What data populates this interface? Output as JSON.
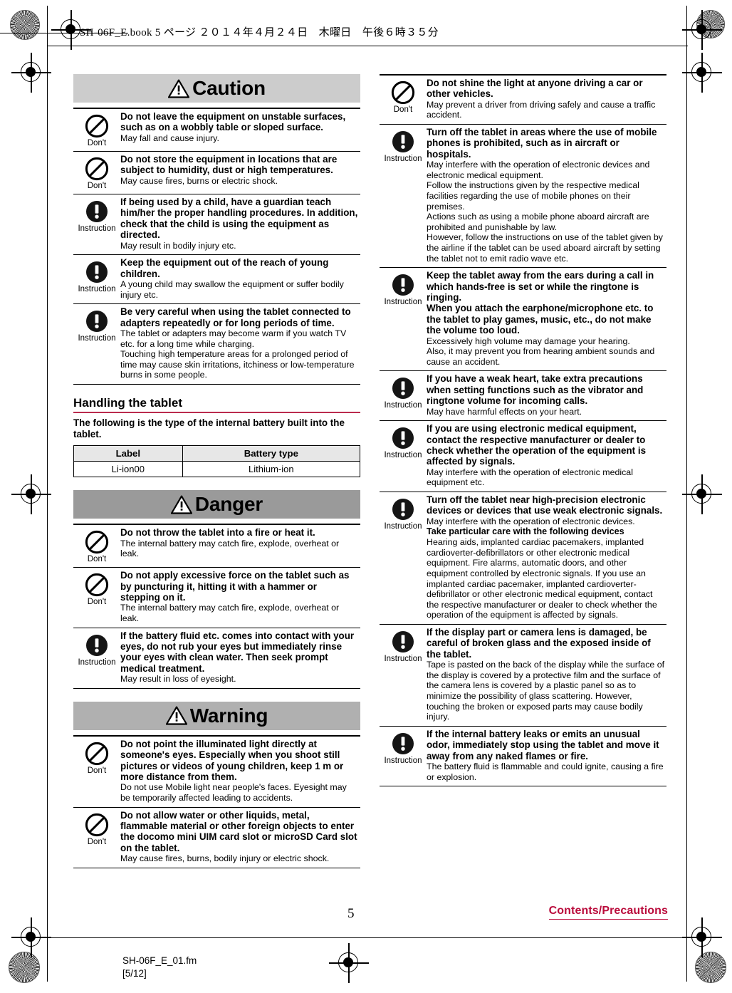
{
  "print_header": "SH-06F_E.book  5 ページ  ２０１４年４月２４日　木曜日　午後６時３５分",
  "footer": {
    "file_name": "SH-06F_E_01.fm",
    "file_page": "[5/12]",
    "page_number": "5",
    "tab_label": "Contents/Precautions"
  },
  "colors": {
    "accent": "#ba0c3c",
    "heading_rule": "#ba2b4e",
    "caution_banner": "#cccccc",
    "danger_banner": "#9a9a9a",
    "warning_banner": "#b0b0b0"
  },
  "icons": {
    "dont": "prohibition-icon",
    "instruction": "instruction-icon",
    "warning_triangle": "warning-triangle-icon"
  },
  "left_column": {
    "caution": {
      "banner": "Caution",
      "items": [
        {
          "icon": "dont",
          "icon_label": "Don't",
          "title": "Do not leave the equipment on unstable surfaces, such as on a wobbly table or sloped surface.",
          "body": [
            "May fall and cause injury."
          ]
        },
        {
          "icon": "dont",
          "icon_label": "Don't",
          "title": "Do not store the equipment in locations that are subject to humidity, dust or high temperatures.",
          "body": [
            "May cause fires, burns or electric shock."
          ]
        },
        {
          "icon": "instruction",
          "icon_label": "Instruction",
          "title": "If being used by a child, have a guardian teach him/her the proper handling procedures. In addition, check that the child is using the equipment as directed.",
          "body": [
            "May result in bodily injury etc."
          ]
        },
        {
          "icon": "instruction",
          "icon_label": "Instruction",
          "title": "Keep the equipment out of the reach of young children.",
          "body": [
            "A young child may swallow the equipment or suffer bodily injury etc."
          ]
        },
        {
          "icon": "instruction",
          "icon_label": "Instruction",
          "title": "Be very careful when using the tablet connected to adapters repeatedly or for long periods of time.",
          "body": [
            "The tablet or adapters may become warm if you watch TV etc. for a long time while charging.",
            "Touching high temperature areas for a prolonged period of time may cause skin irritations, itchiness or low-temperature burns in some people."
          ]
        }
      ]
    },
    "section": {
      "heading": "Handling the tablet",
      "intro": "The following is the type of the internal battery built into the tablet.",
      "table": {
        "headers": [
          "Label",
          "Battery type"
        ],
        "rows": [
          [
            "Li-ion00",
            "Lithium-ion"
          ]
        ]
      }
    },
    "danger": {
      "banner": "Danger",
      "items": [
        {
          "icon": "dont",
          "icon_label": "Don't",
          "title": "Do not throw the tablet into a fire or heat it.",
          "body": [
            "The internal battery may catch fire, explode, overheat or leak."
          ]
        },
        {
          "icon": "dont",
          "icon_label": "Don't",
          "title": "Do not apply excessive force on the tablet such as by puncturing it, hitting it with a hammer or stepping on it.",
          "body": [
            "The internal battery may catch fire, explode, overheat or leak."
          ]
        },
        {
          "icon": "instruction",
          "icon_label": "Instruction",
          "title": "If the battery fluid etc. comes into contact with your eyes, do not rub your eyes but immediately rinse your eyes with clean water. Then seek prompt medical treatment.",
          "body": [
            "May result in loss of eyesight."
          ]
        }
      ]
    },
    "warning": {
      "banner": "Warning",
      "items": [
        {
          "icon": "dont",
          "icon_label": "Don't",
          "title": "Do not point the illuminated light directly at someone's eyes. Especially when you shoot still pictures or videos of young children, keep 1 m or more distance from them.",
          "body": [
            "Do not use Mobile light near people's faces. Eyesight may be temporarily affected leading to accidents."
          ]
        },
        {
          "icon": "dont",
          "icon_label": "Don't",
          "title": "Do not allow water or other liquids, metal, flammable material or other foreign objects to enter the docomo mini UIM card slot or microSD Card slot on the tablet.",
          "body": [
            "May cause fires, burns, bodily injury or electric shock."
          ]
        }
      ]
    }
  },
  "right_column": {
    "items": [
      {
        "icon": "dont",
        "icon_label": "Don't",
        "title": "Do not shine the light at anyone driving a car or other vehicles.",
        "body": [
          "May prevent a driver from driving safely and cause a traffic accident."
        ]
      },
      {
        "icon": "instruction",
        "icon_label": "Instruction",
        "title": "Turn off the tablet in areas where the use of mobile phones is prohibited, such as in aircraft or hospitals.",
        "body": [
          "May interfere with the operation of electronic devices and electronic medical equipment.",
          "Follow the instructions given by the respective medical facilities regarding the use of mobile phones on their premises.",
          "Actions such as using a mobile phone aboard aircraft are prohibited and punishable by law.",
          "However, follow the instructions on use of the tablet given by the airline if the tablet can be used aboard aircraft by setting the tablet not to emit radio wave etc."
        ]
      },
      {
        "icon": "instruction",
        "icon_label": "Instruction",
        "title": "Keep the tablet away from the ears during a call in which hands-free is set or while the ringtone is ringing.",
        "title2": "When you attach the earphone/microphone etc. to the tablet to play games, music, etc., do not make the volume too loud.",
        "body": [
          "Excessively high volume may damage your hearing.",
          "Also, it may prevent you from hearing ambient sounds and cause an accident."
        ]
      },
      {
        "icon": "instruction",
        "icon_label": "Instruction",
        "title": "If you have a weak heart, take extra precautions when setting functions such as the vibrator and ringtone volume for incoming calls.",
        "body": [
          "May have harmful effects on your heart."
        ]
      },
      {
        "icon": "instruction",
        "icon_label": "Instruction",
        "title": "If you are using electronic medical equipment, contact the respective manufacturer or dealer to check whether the operation of the equipment is affected by signals.",
        "body": [
          "May interfere with the operation of electronic medical equipment etc."
        ]
      },
      {
        "icon": "instruction",
        "icon_label": "Instruction",
        "title": "Turn off the tablet near high-precision electronic devices or devices that use weak electronic signals.",
        "body": [
          "May interfere with the operation of electronic devices."
        ],
        "subheading": "Take particular care with the following devices",
        "body2": [
          "Hearing aids, implanted cardiac pacemakers, implanted cardioverter-defibrillators or other electronic medical equipment. Fire alarms, automatic doors, and other equipment controlled by electronic signals. If you use an implanted cardiac pacemaker, implanted cardioverter-defibrillator or other electronic medical equipment, contact the respective manufacturer or dealer to check whether the operation of the equipment is affected by signals."
        ]
      },
      {
        "icon": "instruction",
        "icon_label": "Instruction",
        "title": "If the display part or camera lens is damaged, be careful of broken glass and the exposed inside of the tablet.",
        "body": [
          "Tape is pasted on the back of the display while the surface of the display is covered by a protective film and the surface of the camera lens is covered by a plastic panel so as to minimize the possibility of glass scattering. However, touching the broken or exposed parts may cause bodily injury."
        ]
      },
      {
        "icon": "instruction",
        "icon_label": "Instruction",
        "title": "If the internal battery leaks or emits an unusual odor, immediately stop using the tablet and move it away from any naked flames or fire.",
        "body": [
          "The battery fluid is flammable and could ignite, causing a fire or explosion."
        ]
      }
    ]
  }
}
